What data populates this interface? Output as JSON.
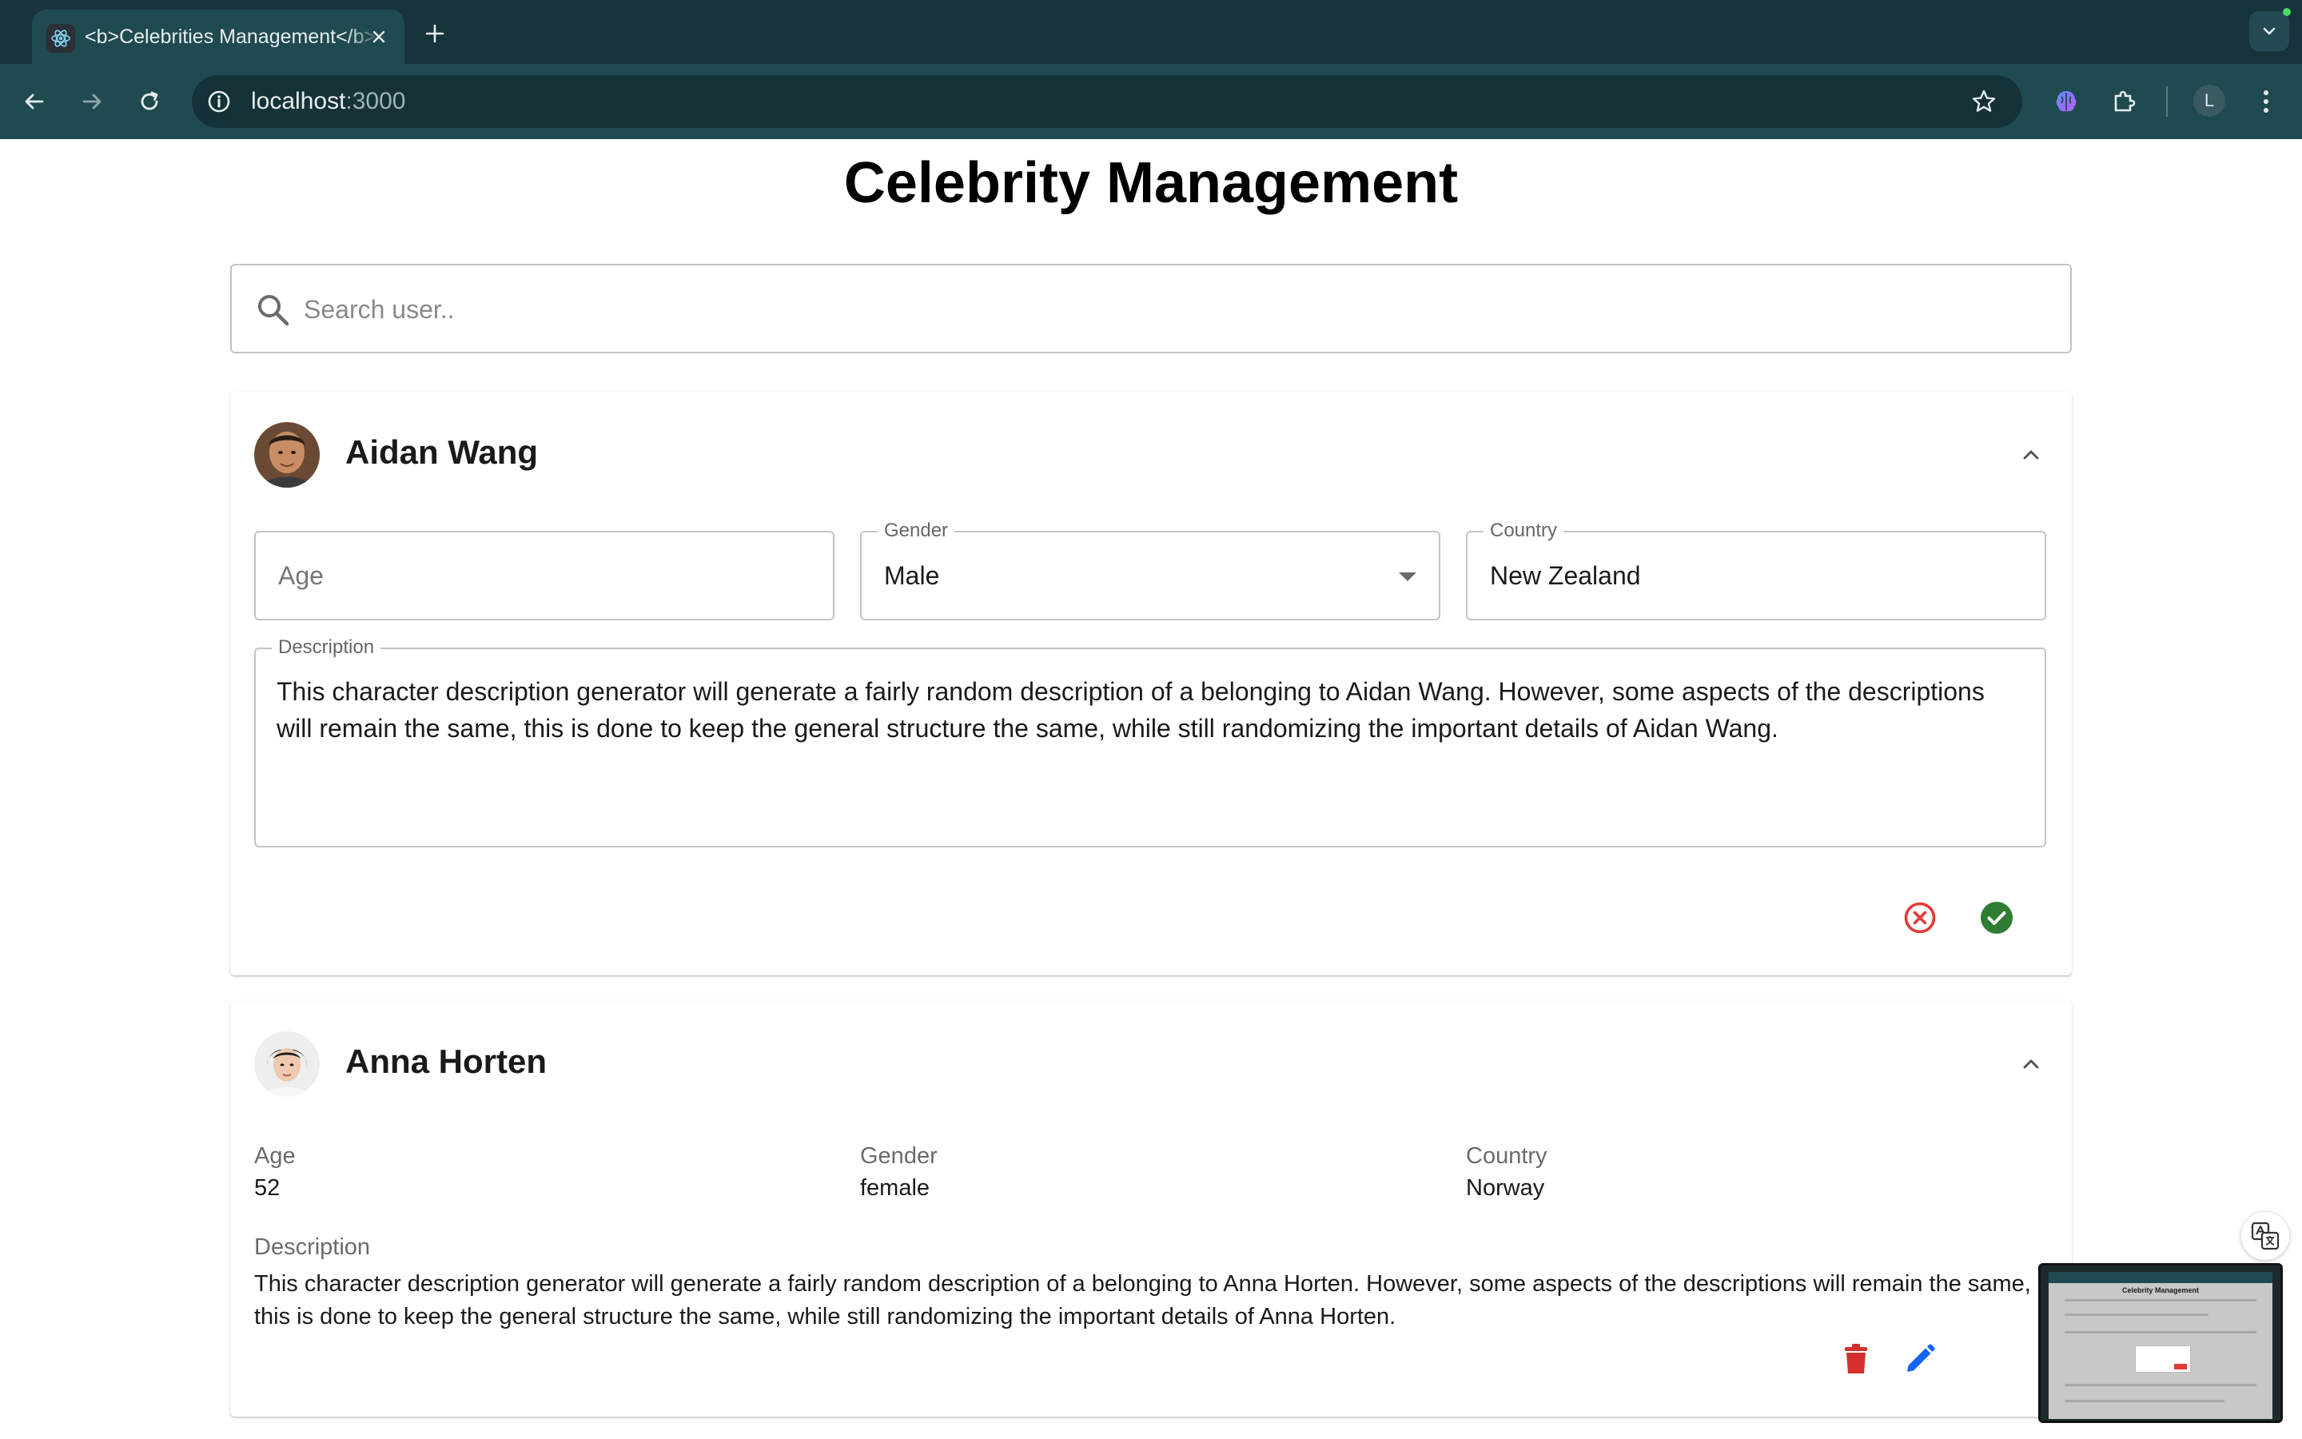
{
  "browser": {
    "tab_title": "<b>Celebrities Management</b>",
    "url_host": "localhost",
    "url_port": ":3000",
    "profile_initial": "L"
  },
  "page": {
    "title": "Celebrity Management",
    "search": {
      "placeholder": "Search user..",
      "value": ""
    }
  },
  "celebrities": [
    {
      "name": "Aidan Wang",
      "mode": "edit",
      "age_placeholder": "Age",
      "gender_label": "Gender",
      "gender": "Male",
      "country_label": "Country",
      "country": "New Zealand",
      "description_label": "Description",
      "description": "This character description generator will generate a fairly random description of a belonging to Aidan Wang. However, some aspects of the descriptions will remain the same, this is done to keep the general structure the same, while still randomizing the important details of Aidan Wang."
    },
    {
      "name": "Anna Horten",
      "mode": "view",
      "age_label": "Age",
      "age": "52",
      "gender_label": "Gender",
      "gender": "female",
      "country_label": "Country",
      "country": "Norway",
      "description_label": "Description",
      "description": "This character description generator will generate a fairly random description of a belonging to Anna Horten. However, some aspects of the descriptions will remain the same, this is done to keep the general structure the same, while still randomizing the important details of Anna Horten."
    }
  ],
  "pip_preview": {
    "title": "Celebrity Management"
  },
  "colors": {
    "cancel": "#e53935",
    "confirm": "#2e7d32",
    "delete": "#d32f2f",
    "edit": "#1565ff",
    "browser_frame": "#1f4a50"
  },
  "icons": {
    "collapse": "chevron-up-icon",
    "cancel": "cancel-circle-icon",
    "confirm": "check-circle-icon",
    "delete": "trash-icon",
    "edit": "pencil-icon"
  }
}
